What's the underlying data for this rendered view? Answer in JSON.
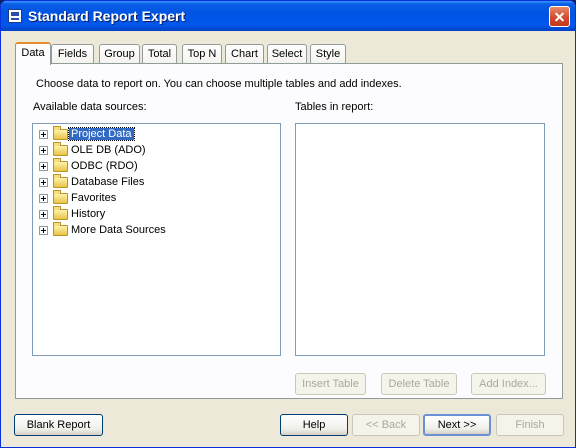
{
  "window": {
    "title": "Standard Report Expert",
    "colors": {
      "titlebar": "#0054e3",
      "face": "#ece9d8",
      "selection": "#316ac5",
      "close": "#d2462a"
    }
  },
  "tabs": [
    {
      "label": "Data",
      "active": true
    },
    {
      "label": "Fields"
    },
    {
      "label": "Group"
    },
    {
      "label": "Total"
    },
    {
      "label": "Top N"
    },
    {
      "label": "Chart"
    },
    {
      "label": "Select"
    },
    {
      "label": "Style"
    }
  ],
  "data_tab": {
    "instructions": "Choose data to report on. You can choose multiple tables and add indexes.",
    "available_label": "Available data sources:",
    "tables_label": "Tables in report:",
    "tree_items": [
      {
        "label": "Project Data",
        "icon": "folder-icon",
        "selected": true
      },
      {
        "label": "OLE DB (ADO)",
        "icon": "folder-icon"
      },
      {
        "label": "ODBC (RDO)",
        "icon": "folder-icon"
      },
      {
        "label": "Database Files",
        "icon": "folder-icon"
      },
      {
        "label": "Favorites",
        "icon": "folder-icon"
      },
      {
        "label": "History",
        "icon": "folder-icon"
      },
      {
        "label": "More Data Sources",
        "icon": "folder-icon"
      }
    ],
    "tables_in_report": [],
    "buttons": {
      "insert_table": "Insert Table",
      "delete_table": "Delete Table",
      "add_index": "Add Index..."
    }
  },
  "footer": {
    "blank_report": "Blank Report",
    "help": "Help",
    "back": "<< Back",
    "next": "Next >>",
    "finish": "Finish"
  }
}
